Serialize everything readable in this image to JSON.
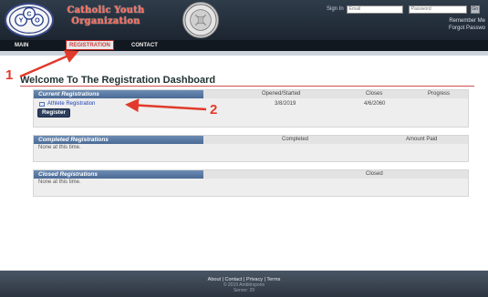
{
  "header": {
    "org_name_line1": "Catholic Youth",
    "org_name_line2": "Organization",
    "logo_letters": [
      "C",
      "Y",
      "O"
    ],
    "login_label": "Sign In",
    "email_placeholder": "Email",
    "password_placeholder": "Password",
    "login_button": "Go",
    "remember_me": "Remember Me",
    "forgot_password": "Forgot Passwo"
  },
  "nav": {
    "items": [
      {
        "label": "MAIN"
      },
      {
        "label": "REGISTRATION"
      },
      {
        "label": "CONTACT"
      }
    ]
  },
  "page": {
    "title": "Welcome To The Registration Dashboard"
  },
  "current": {
    "tab_label": "Current Registrations",
    "col_opened": "Opened/Started",
    "col_closes": "Closes",
    "col_progress": "Progress",
    "row": {
      "name": "Athlete Registration",
      "opened": "3/8/2019",
      "closes": "4/6/2060"
    },
    "register_button": "Register"
  },
  "completed": {
    "tab_label": "Completed Registrations",
    "col_completed": "Completed",
    "col_amount": "Amount Paid",
    "empty_text": "None at this time."
  },
  "closed": {
    "tab_label": "Closed Registrations",
    "col_closed": "Closed",
    "empty_text": "None at this time."
  },
  "footer": {
    "links": "About | Contact | Privacy | Terms",
    "copyright": "© 2019 Ambitrsports",
    "server": "Server: 29"
  },
  "annotations": {
    "callout_1": "1",
    "callout_2": "2",
    "arrow_color": "#e23a2a"
  }
}
